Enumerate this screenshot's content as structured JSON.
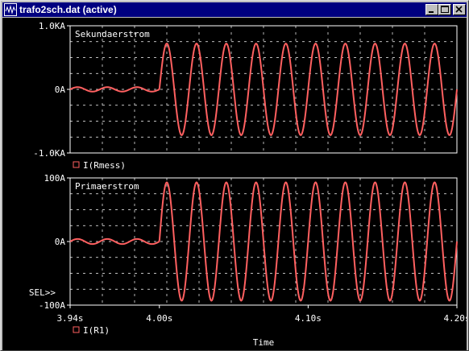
{
  "window": {
    "title": "trafo2sch.dat (active)",
    "buttons": [
      "minimize",
      "maximize",
      "close"
    ]
  },
  "plot": {
    "colors": {
      "background": "#000000",
      "grid": "#ffffff",
      "text": "#ffffff",
      "trace": "#ff6060"
    },
    "x_axis": {
      "label": "Time",
      "range": [
        3.94,
        4.2
      ],
      "unit": "s",
      "ticks": [
        3.94,
        4.0,
        4.1,
        4.2
      ],
      "tick_labels": [
        "3.94s",
        "4.00s",
        "4.10s",
        "4.20s"
      ]
    },
    "selection_marker": "SEL>>"
  },
  "chart_data": [
    {
      "type": "line",
      "title": "Sekundaerstrom",
      "y_range": [
        -1000,
        1000
      ],
      "y_unit": "A",
      "y_tick_labels": [
        "1.0KA",
        "0A",
        "-1.0KA"
      ],
      "y_ticks": [
        1000,
        0,
        -1000
      ],
      "legend": "I(Rmess)",
      "grid": true,
      "series": [
        {
          "name": "I(Rmess)",
          "segments": [
            {
              "from": 3.94,
              "to": 4.0,
              "shape": "small oscillation",
              "amplitude": 35,
              "frequency_hz": 50
            },
            {
              "from": 4.0,
              "to": 4.2,
              "shape": "sine",
              "amplitude": 720,
              "frequency_hz": 50,
              "offset": 0
            }
          ],
          "key_points": [
            {
              "x": 3.94,
              "y": 0
            },
            {
              "x": 4.0,
              "y": 0
            },
            {
              "x": 4.005,
              "y": 720
            },
            {
              "x": 4.015,
              "y": -720
            },
            {
              "x": 4.025,
              "y": 720
            },
            {
              "x": 4.035,
              "y": -720
            },
            {
              "x": 4.2,
              "y": 0
            }
          ]
        }
      ]
    },
    {
      "type": "line",
      "title": "Primaerstrom",
      "y_range": [
        -100,
        100
      ],
      "y_unit": "A",
      "y_tick_labels": [
        "100A",
        "0A",
        "-100A"
      ],
      "y_ticks": [
        100,
        0,
        -100
      ],
      "legend": "I(R1)",
      "grid": true,
      "series": [
        {
          "name": "I(R1)",
          "segments": [
            {
              "from": 3.94,
              "to": 4.0,
              "shape": "small oscillation",
              "amplitude": 4,
              "frequency_hz": 50
            },
            {
              "from": 4.0,
              "to": 4.2,
              "shape": "sine",
              "amplitude": 93,
              "frequency_hz": 50,
              "offset": 0
            }
          ],
          "key_points": [
            {
              "x": 3.94,
              "y": 0
            },
            {
              "x": 4.0,
              "y": 0
            },
            {
              "x": 4.005,
              "y": 93
            },
            {
              "x": 4.015,
              "y": -93
            },
            {
              "x": 4.025,
              "y": 93
            },
            {
              "x": 4.035,
              "y": -93
            },
            {
              "x": 4.2,
              "y": 0
            }
          ]
        }
      ]
    }
  ]
}
